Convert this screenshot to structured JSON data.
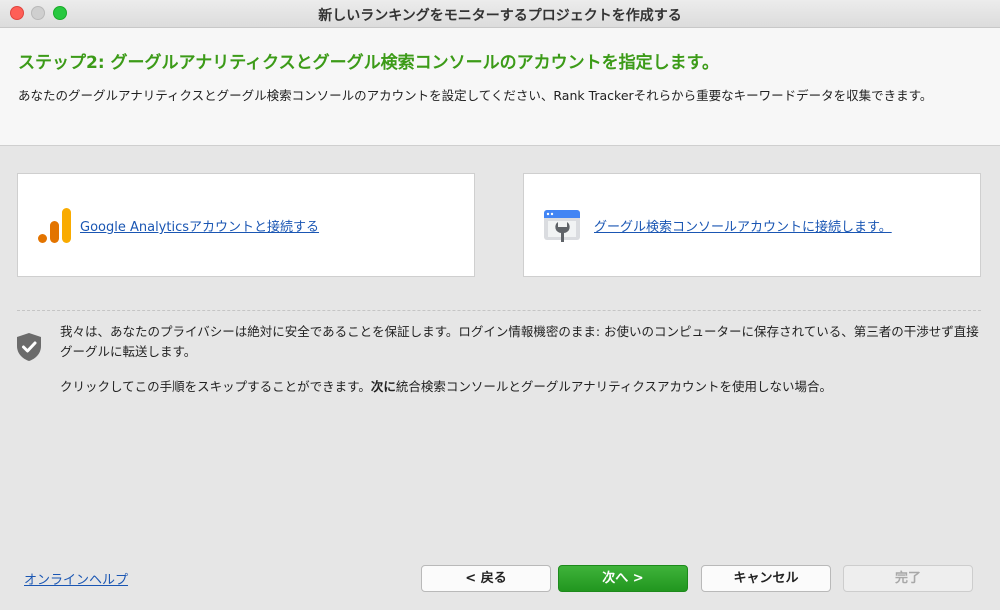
{
  "window": {
    "title": "新しいランキングをモニターするプロジェクトを作成する"
  },
  "header": {
    "title": "ステップ2: グーグルアナリティクスとグーグル検索コンソールのアカウントを指定します。",
    "description": "あなたのグーグルアナリティクスとグーグル検索コンソールのアカウントを設定してください、Rank Trackerそれらから重要なキーワードデータを収集できます。"
  },
  "cards": {
    "analytics": {
      "icon": "google-analytics-icon",
      "link_label": "Google Analyticsアカウントと接続する"
    },
    "search_console": {
      "icon": "search-console-icon",
      "link_label": "グーグル検索コンソールアカウントに接続します。"
    }
  },
  "privacy": {
    "icon": "shield-check-icon",
    "text": "我々は、あなたのプライバシーは絶対に安全であることを保証します。ログイン情報機密のまま: お使いのコンピューターに保存されている、第三者の干渉せず直接グーグルに転送します。",
    "skip_prefix": "クリックしてこの手順をスキップすることができます。",
    "skip_bold": "次に",
    "skip_suffix": "統合検索コンソールとグーグルアナリティクスアカウントを使用しない場合。"
  },
  "footer": {
    "help_link": "オンラインヘルプ",
    "back_label": "< 戻る",
    "next_label": "次へ >",
    "cancel_label": "キャンセル",
    "finish_label": "完了"
  },
  "colors": {
    "step_title": "#3c9b18",
    "link": "#1a56b3",
    "primary_button": "#2aa428",
    "analytics_orange": "#f9ab00"
  }
}
